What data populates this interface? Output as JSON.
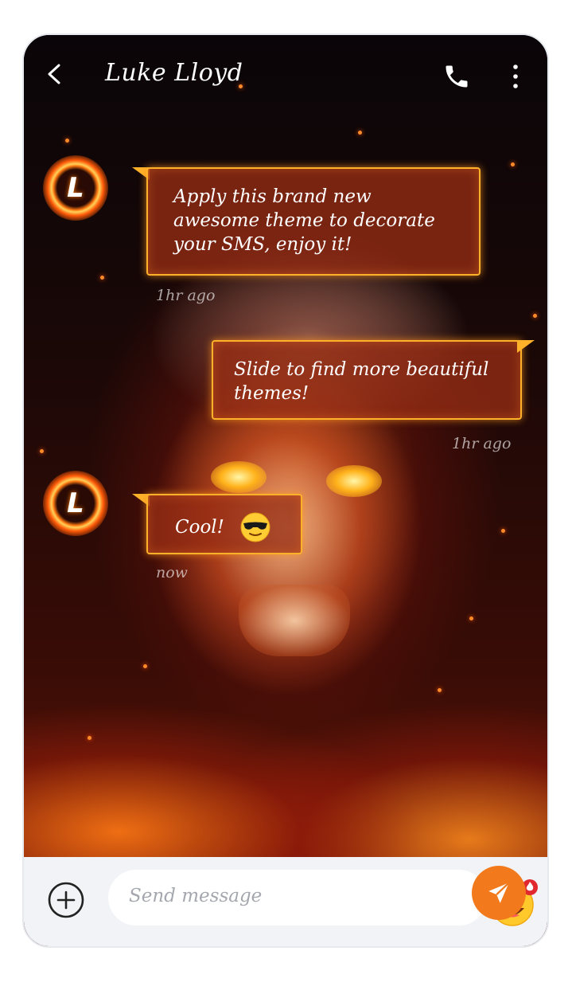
{
  "header": {
    "contact_name": "Luke Lloyd"
  },
  "icons": {
    "back": "chevron-left-icon",
    "call": "phone-icon",
    "more": "more-vertical-icon",
    "add": "plus-circle-icon",
    "emoji": "emoji-icon",
    "send": "send-icon",
    "sunglasses": "sunglasses-emoji"
  },
  "messages": [
    {
      "sender": "contact",
      "avatar_letter": "L",
      "text_lines": [
        "Apply this brand new",
        "awesome theme to decorate",
        "your SMS, enjoy it!"
      ],
      "time": "1hr ago"
    },
    {
      "sender": "me",
      "text_lines": [
        "Slide to find more beautiful",
        "themes!"
      ],
      "time": "1hr ago"
    },
    {
      "sender": "contact",
      "avatar_letter": "L",
      "text": "Cool!",
      "emoji": "sunglasses-emoji",
      "time": "now"
    }
  ],
  "composer": {
    "placeholder": "Send message"
  },
  "colors": {
    "bubble_border": "#ffb12a",
    "send_button": "#f27a1c",
    "input_bar": "#f1f3f7"
  }
}
